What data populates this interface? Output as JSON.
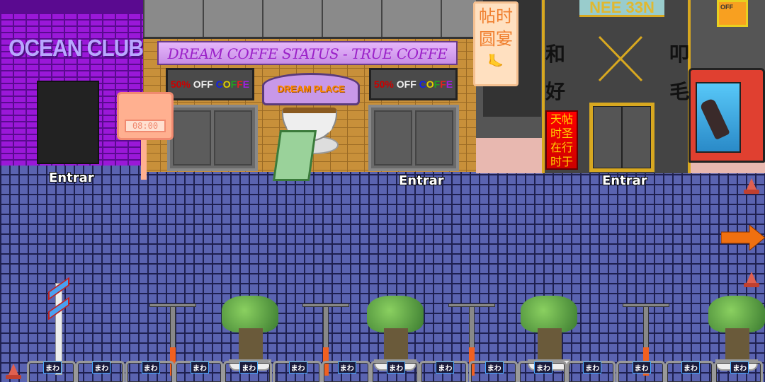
{
  "club": {
    "name": "OCEAN CLUB",
    "enter_label": "Entrar"
  },
  "cat_clock": {
    "time": "08:00"
  },
  "cafe": {
    "banner": "DREAM COFFE STATUS - TRUE COFFE",
    "arch_sign": "DREAM PLACE CAFE",
    "promo": {
      "percent": "50%",
      "off": "OFF",
      "word_letters": [
        "C",
        "O",
        "F",
        "F",
        "E"
      ],
      "word_colors": [
        "#1020f0",
        "#e0d000",
        "#20a020",
        "#e02020",
        "#a020e0"
      ]
    },
    "enter_label": "Entrar"
  },
  "shop": {
    "neon_sign": "NEE 33N",
    "hanging_poster": [
      "帖时",
      "圆宴"
    ],
    "red_sign": [
      "天帖",
      "时圣",
      "在行",
      "时于"
    ],
    "wall_glyphs": [
      "和",
      "好",
      "叩",
      "毛"
    ],
    "poster": "OFF",
    "enter_label": "Entrar"
  },
  "railing": {
    "labels": [
      "まわ",
      "まわ",
      "まわ",
      "まわ",
      "まわ",
      "まわ",
      "まわ",
      "まわ",
      "まわ",
      "まわ",
      "まわ",
      "まわ",
      "まわ",
      "まわ",
      "まわ"
    ]
  },
  "navigation": {
    "next_area_icon": "arrow-right-icon",
    "arrow_color": "#f07010"
  }
}
